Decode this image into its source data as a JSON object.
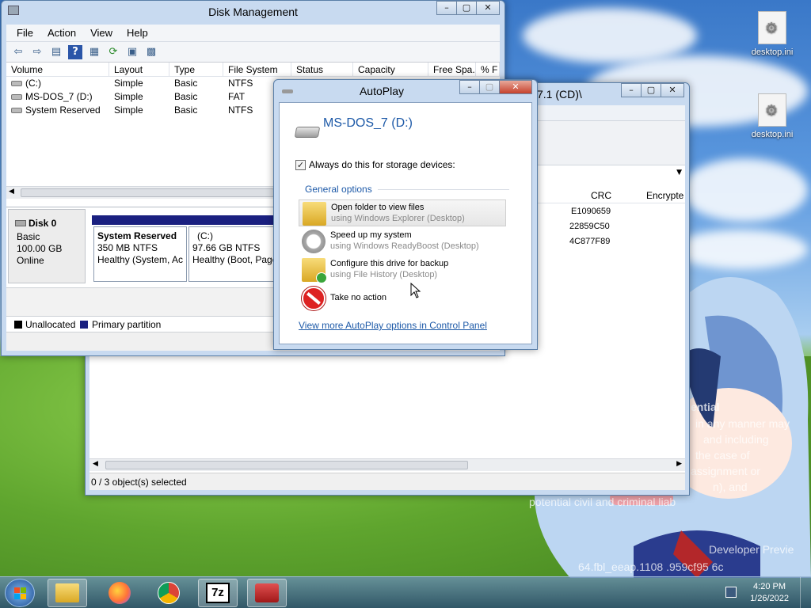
{
  "desktop": {
    "icons": [
      {
        "label": "desktop.ini"
      },
      {
        "label": "desktop.ini"
      }
    ],
    "watermark": {
      "line1": "ential",
      "line2": "in any manner may",
      "line3": "and including",
      "line4": "the case of",
      "line5": "assignment or",
      "line6": "n), and",
      "line7": "potential civil and criminal liab",
      "line8": "Developer Previe",
      "line9": "64.fbl_eeap.1108 .959cf95 6c"
    }
  },
  "disk_mgmt": {
    "title": "Disk Management",
    "menu": [
      "File",
      "Action",
      "View",
      "Help"
    ],
    "columns": [
      "Volume",
      "Layout",
      "Type",
      "File System",
      "Status",
      "Capacity",
      "Free Spa...",
      "% F"
    ],
    "volumes": [
      {
        "volume": "(C:)",
        "layout": "Simple",
        "type": "Basic",
        "fs": "NTFS"
      },
      {
        "volume": "MS-DOS_7 (D:)",
        "layout": "Simple",
        "type": "Basic",
        "fs": "FAT"
      },
      {
        "volume": "System Reserved",
        "layout": "Simple",
        "type": "Basic",
        "fs": "NTFS"
      }
    ],
    "disk0": {
      "name": "Disk 0",
      "type": "Basic",
      "size": "100.00 GB",
      "status": "Online"
    },
    "partitions": [
      {
        "name": "System Reserved",
        "size": "350 MB NTFS",
        "status": "Healthy (System, Ac"
      },
      {
        "name": "(C:)",
        "size": "97.66 GB NTFS",
        "status": "Healthy (Boot, Page"
      }
    ],
    "legend": {
      "unallocated": "Unallocated",
      "primary": "Primary partition",
      "unallocated_color": "#000000",
      "primary_color": "#1a2080"
    }
  },
  "explorer": {
    "title_partial": "7.1 (CD)\\",
    "columns": [
      "CRC",
      "Encrypte"
    ],
    "rows": [
      "E1090659",
      "22859C50",
      "4C877F89"
    ],
    "status": "0 / 3 object(s) selected"
  },
  "autoplay": {
    "title": "AutoPlay",
    "drive": "MS-DOS_7 (D:)",
    "always_label": "Always do this for storage devices:",
    "always_checked": true,
    "group_title": "General options",
    "options": [
      {
        "title": "Open folder to view files",
        "sub": "using Windows Explorer (Desktop)",
        "icon": "folder-icon"
      },
      {
        "title": "Speed up my system",
        "sub": "using Windows ReadyBoost (Desktop)",
        "icon": "stopwatch-icon"
      },
      {
        "title": "Configure this drive for backup",
        "sub": "using File History (Desktop)",
        "icon": "backup-folder-icon"
      },
      {
        "title": "Take no action",
        "sub": "",
        "icon": "no-entry-icon"
      }
    ],
    "link": "View more AutoPlay options in Control Panel",
    "accent": "#1e5aa8"
  },
  "taskbar": {
    "time": "4:20 PM",
    "date": "1/26/2022",
    "apps": [
      "explorer",
      "firefox",
      "chrome",
      "7-zip",
      "toolbox"
    ],
    "sevenzip_label": "7z"
  }
}
